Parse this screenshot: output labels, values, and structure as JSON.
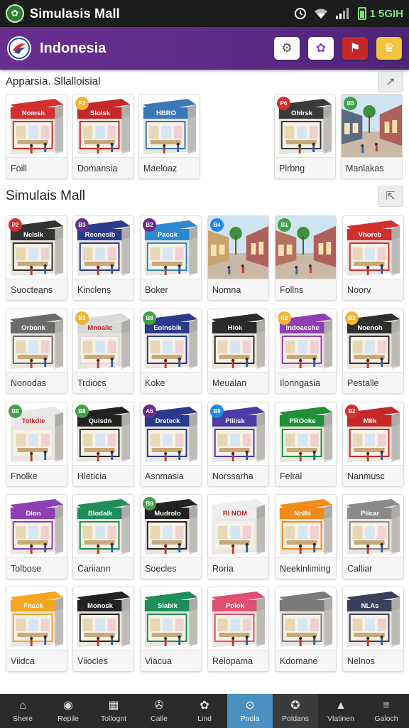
{
  "status_bar": {
    "app_title": "Simulasis Mall",
    "battery_text": "1 5GIH",
    "icons": [
      "clock-icon",
      "wifi-icon",
      "signal-icon",
      "battery-icon"
    ]
  },
  "header": {
    "title": "Indonesia",
    "actions": [
      {
        "name": "gears-button",
        "icon": "⚙",
        "bg": "#ffffff",
        "fg": "#555555"
      },
      {
        "name": "share-button",
        "icon": "✿",
        "bg": "#ffffff",
        "fg": "#8a4bb0"
      },
      {
        "name": "alert-button",
        "icon": "⚑",
        "bg": "#c62828",
        "fg": "#ffffff"
      },
      {
        "name": "favorite-button",
        "icon": "♛",
        "bg": "#f2c33b",
        "fg": "#ffffff"
      }
    ]
  },
  "sections": [
    {
      "title": "Apparsia. Sllalloisial",
      "collapse_icon": "↗"
    },
    {
      "title": "Simulais Mall",
      "collapse_icon": "⇱"
    }
  ],
  "featured_stores": [
    {
      "label": "Foill",
      "sign": "Nomsh",
      "color": "#d32f2f",
      "badge": "",
      "badge_color": ""
    },
    {
      "label": "Domansia",
      "sign": "Slolsk",
      "color": "#c62828",
      "badge": "P2",
      "badge_color": "#f2b53a"
    },
    {
      "label": "Maeloaz",
      "sign": "HBRO",
      "color": "#3b78b8",
      "badge": "",
      "badge_color": ""
    },
    {
      "label": "Plrbng",
      "sign": "Ohlrsk",
      "color": "#3a3a3a",
      "badge": "P6",
      "badge_color": "#d32f2f"
    },
    {
      "label": "Manlakas",
      "sign": "",
      "color": "#5a6a80",
      "badge": "B5",
      "badge_color": "#43a047",
      "street": true
    }
  ],
  "mall_stores": [
    {
      "label": "Suocteans",
      "sign": "Nelslk",
      "color": "#333333",
      "badge": "P2",
      "badge_color": "#d32f2f"
    },
    {
      "label": "Kinclens",
      "sign": "Reonesib",
      "color": "#2b3a8c",
      "badge": "B3",
      "badge_color": "#6a2e8f"
    },
    {
      "label": "Boker",
      "sign": "Pacok",
      "color": "#2d89cf",
      "badge": "B2",
      "badge_color": "#6a2e8f"
    },
    {
      "label": "Nomna",
      "sign": "",
      "color": "#c9a46d",
      "badge": "B4",
      "badge_color": "#1e88e5",
      "street": true
    },
    {
      "label": "Follns",
      "sign": "",
      "color": "#b5705e",
      "badge": "B1",
      "badge_color": "#43a047",
      "street": true
    },
    {
      "label": "Noorv",
      "sign": "Vhoreb",
      "color": "#d32f2f",
      "badge": "",
      "badge_color": ""
    },
    {
      "label": "Nonodas",
      "sign": "Orbonk",
      "color": "#6b6b6b",
      "badge": "",
      "badge_color": ""
    },
    {
      "label": "Trdiocs",
      "sign": "Mnoalic",
      "color": "#d9d9d9",
      "badge": "B2",
      "badge_color": "#f2b53a"
    },
    {
      "label": "Koke",
      "sign": "Eolnsbik",
      "color": "#2b3a8c",
      "badge": "B8",
      "badge_color": "#43a047"
    },
    {
      "label": "Meualan",
      "sign": "Hiok",
      "color": "#2a2a2a",
      "badge": "",
      "badge_color": ""
    },
    {
      "label": "Ilonngasia",
      "sign": "Indoaeshe",
      "color": "#8e3fb5",
      "badge": "B2",
      "badge_color": "#f2b53a"
    },
    {
      "label": "Pestalle",
      "sign": "Noenoh",
      "color": "#2f2f2f",
      "badge": "B2",
      "badge_color": "#f2b53a"
    },
    {
      "label": "Fnolke",
      "sign": "Tolkdie",
      "color": "#e8e8e8",
      "badge": "B8",
      "badge_color": "#43a047"
    },
    {
      "label": "Hleticia",
      "sign": "Quisdn",
      "color": "#222222",
      "badge": "B8",
      "badge_color": "#43a047"
    },
    {
      "label": "Asnmasia",
      "sign": "Dreteck",
      "color": "#2b3a8c",
      "badge": "A6",
      "badge_color": "#6a2e8f"
    },
    {
      "label": "Norssarha",
      "sign": "Plilisk",
      "color": "#4b3aa8",
      "badge": "B9",
      "badge_color": "#1e88e5"
    },
    {
      "label": "Felral",
      "sign": "PROoke",
      "color": "#1f8f3a",
      "badge": "",
      "badge_color": ""
    },
    {
      "label": "Nanmusc",
      "sign": "Mlik",
      "color": "#c62828",
      "badge": "B2",
      "badge_color": "#d32f2f"
    },
    {
      "label": "Tolbose",
      "sign": "Dlon",
      "color": "#8e3fb5",
      "badge": "",
      "badge_color": ""
    },
    {
      "label": "Cariiann",
      "sign": "Blodalk",
      "color": "#1f8f5a",
      "badge": "",
      "badge_color": ""
    },
    {
      "label": "Soecles",
      "sign": "Mudrolo",
      "color": "#222222",
      "badge": "B8",
      "badge_color": "#43a047"
    },
    {
      "label": "Roria",
      "sign": "RI NOM",
      "color": "#eeeeee",
      "badge": "",
      "badge_color": ""
    },
    {
      "label": "Neekinliming",
      "sign": "Nnlfé",
      "color": "#f08c1a",
      "badge": "",
      "badge_color": ""
    },
    {
      "label": "Calliar",
      "sign": "Plicar",
      "color": "#8a8a8a",
      "badge": "",
      "badge_color": ""
    },
    {
      "label": "Viidca",
      "sign": "Fnack",
      "color": "#f5a623",
      "badge": "",
      "badge_color": ""
    },
    {
      "label": "Viiocles",
      "sign": "Monosk",
      "color": "#222222",
      "badge": "",
      "badge_color": ""
    },
    {
      "label": "Viacua",
      "sign": "Slabik",
      "color": "#1f8f5a",
      "badge": "",
      "badge_color": ""
    },
    {
      "label": "Relopama",
      "sign": "Polok",
      "color": "#e05070",
      "badge": "",
      "badge_color": ""
    },
    {
      "label": "Kdomane",
      "sign": "",
      "color": "#7a7a7a",
      "badge": "",
      "badge_color": ""
    },
    {
      "label": "Nelnos",
      "sign": "NLAs",
      "color": "#3a3f5a",
      "badge": "",
      "badge_color": ""
    }
  ],
  "bottom_nav": [
    {
      "label": "Shere",
      "icon": "⌂",
      "state": ""
    },
    {
      "label": "Repile",
      "icon": "◉",
      "state": ""
    },
    {
      "label": "Tollognt",
      "icon": "▦",
      "state": ""
    },
    {
      "label": "Calle",
      "icon": "✇",
      "state": ""
    },
    {
      "label": "Lind",
      "icon": "✿",
      "state": ""
    },
    {
      "label": "Pnola",
      "icon": "⊙",
      "state": "active"
    },
    {
      "label": "Poldans",
      "icon": "✪",
      "state": "semi"
    },
    {
      "label": "Vlatinen",
      "icon": "▲",
      "state": ""
    },
    {
      "label": "Galoch",
      "icon": "≡",
      "state": ""
    }
  ]
}
